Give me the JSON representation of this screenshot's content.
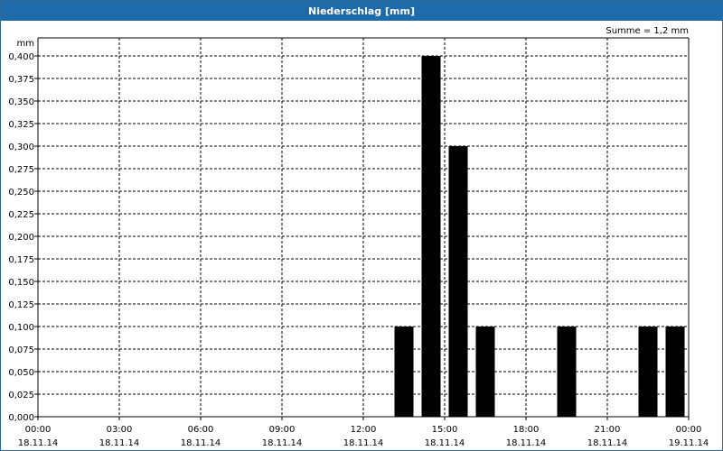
{
  "window": {
    "title": "Niederschlag [mm]"
  },
  "chart_data": {
    "type": "bar",
    "title": "Niederschlag [mm]",
    "ylabel": "mm",
    "annotation": "Summe = 1,2 mm",
    "ylim": [
      0,
      0.4
    ],
    "y_ticks": [
      "0,000",
      "0,025",
      "0,050",
      "0,075",
      "0,100",
      "0,125",
      "0,150",
      "0,175",
      "0,200",
      "0,225",
      "0,250",
      "0,275",
      "0,300",
      "0,325",
      "0,350",
      "0,375",
      "0,400"
    ],
    "x_ticks": [
      {
        "time": "00:00",
        "date": "18.11.14"
      },
      {
        "time": "03:00",
        "date": "18.11.14"
      },
      {
        "time": "06:00",
        "date": "18.11.14"
      },
      {
        "time": "09:00",
        "date": "18.11.14"
      },
      {
        "time": "12:00",
        "date": "18.11.14"
      },
      {
        "time": "15:00",
        "date": "18.11.14"
      },
      {
        "time": "18:00",
        "date": "18.11.14"
      },
      {
        "time": "21:00",
        "date": "18.11.14"
      },
      {
        "time": "00:00",
        "date": "19.11.14"
      }
    ],
    "x_range_hours": [
      0,
      24
    ],
    "bars": [
      {
        "hour": 13,
        "value": 0.1
      },
      {
        "hour": 14,
        "value": 0.4
      },
      {
        "hour": 15,
        "value": 0.3
      },
      {
        "hour": 16,
        "value": 0.1
      },
      {
        "hour": 19,
        "value": 0.1
      },
      {
        "hour": 22,
        "value": 0.1
      },
      {
        "hour": 23,
        "value": 0.1
      }
    ],
    "bar_color": "#000000",
    "grid": true
  }
}
